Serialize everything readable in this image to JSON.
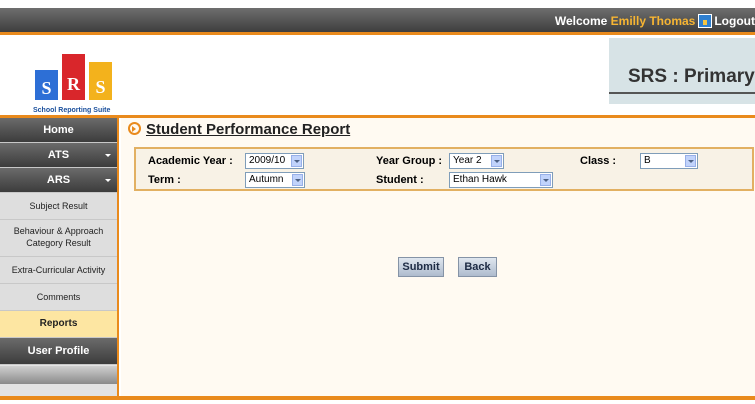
{
  "topbar": {
    "welcome_prefix": "Welcome",
    "user_name": "Emilly Thomas",
    "logout_label": "Logout"
  },
  "header": {
    "logo": {
      "letters": [
        "S",
        "R",
        "S"
      ],
      "tagline": "School Reporting Suite"
    },
    "title": "SRS : Primary"
  },
  "sidebar": {
    "items": [
      {
        "label": "Home"
      },
      {
        "label": "ATS"
      },
      {
        "label": "ARS"
      },
      {
        "label": "Subject Result"
      },
      {
        "label": "Behaviour & Approach Category Result"
      },
      {
        "label": "Extra-Curricular Activity"
      },
      {
        "label": "Comments"
      },
      {
        "label": "Reports"
      },
      {
        "label": "User Profile"
      }
    ]
  },
  "main": {
    "page_title": "Student Performance Report",
    "filters": {
      "academic_year": {
        "label": "Academic Year :",
        "value": "2009/10"
      },
      "year_group": {
        "label": "Year Group :",
        "value": "Year 2"
      },
      "class": {
        "label": "Class :",
        "value": "B"
      },
      "term": {
        "label": "Term :",
        "value": "Autumn"
      },
      "student": {
        "label": "Student :",
        "value": "Ethan Hawk"
      }
    },
    "buttons": {
      "submit": "Submit",
      "back": "Back"
    }
  },
  "colors": {
    "accent": "#e98a1c",
    "username": "#f7b532",
    "active_nav": "#fde6a2"
  }
}
